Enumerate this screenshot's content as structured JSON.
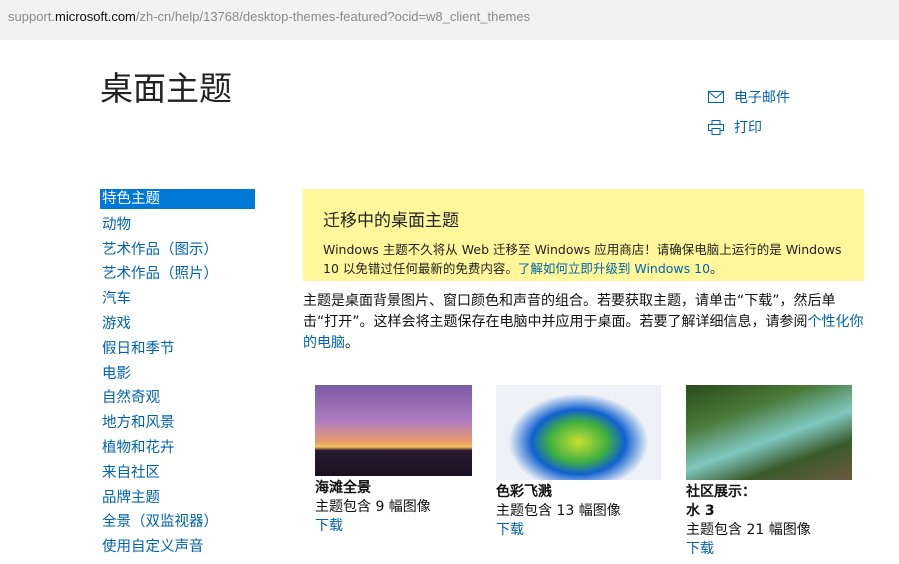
{
  "url": {
    "prefix": "support.",
    "host": "microsoft.com",
    "path": "/zh-cn/help/13768/desktop-themes-featured?ocid=w8_client_themes"
  },
  "page_title": "桌面主题",
  "actions": {
    "email": "电子邮件",
    "print": "打印"
  },
  "sidebar": {
    "items": [
      {
        "label": "特色主题",
        "active": true
      },
      {
        "label": "动物"
      },
      {
        "label": "艺术作品（图示）"
      },
      {
        "label": "艺术作品（照片）"
      },
      {
        "label": "汽车"
      },
      {
        "label": "游戏"
      },
      {
        "label": "假日和季节"
      },
      {
        "label": "电影"
      },
      {
        "label": "自然奇观"
      },
      {
        "label": "地方和风景"
      },
      {
        "label": "植物和花卉"
      },
      {
        "label": "来自社区"
      },
      {
        "label": "品牌主题"
      },
      {
        "label": "全景（双监视器）"
      },
      {
        "label": "使用自定义声音"
      }
    ]
  },
  "notice": {
    "title": "迁移中的桌面主题",
    "text": "Windows 主题不久将从 Web 迁移至 Windows 应用商店！请确保电脑上运行的是 Windows 10 以免错过任何最新的免费内容。",
    "link": "了解如何立即升级到 Windows 10",
    "end": "。"
  },
  "intro": {
    "text": "主题是桌面背景图片、窗口颜色和声音的组合。若要获取主题，请单击“下载”，然后单击“打开”。这样会将主题保存在电脑中并应用于桌面。若要了解详细信息，请参阅",
    "link": "个性化你的电脑",
    "end": "。"
  },
  "themes": [
    {
      "name": "海滩全景",
      "count": "主题包含 9 幅图像",
      "download": "下载"
    },
    {
      "name": "色彩飞溅",
      "count": "主题包含 13 幅图像",
      "download": "下载"
    },
    {
      "name": "社区展示：",
      "name2": "水 3",
      "count": "主题包含 21 幅图像",
      "download": "下载"
    }
  ]
}
